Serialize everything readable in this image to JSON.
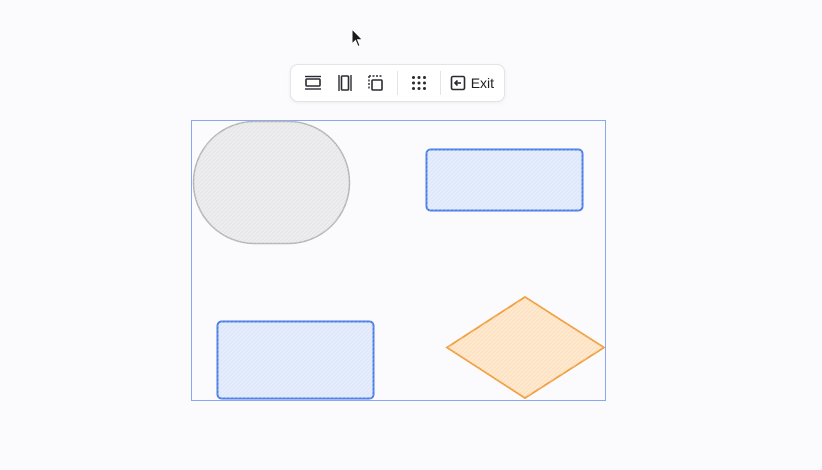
{
  "toolbar": {
    "icons": [
      "distribute-horizontal-icon",
      "distribute-vertical-icon",
      "align-center-icon",
      "grid-icon",
      "exit-icon"
    ],
    "exit_label": "Exit"
  },
  "colors": {
    "selection": "#8aa8ee",
    "rect_fill": "#dfe8fb",
    "rect_stroke": "#4b7fe6",
    "oval_fill": "#e8e8ea",
    "oval_stroke": "#b5b5b8",
    "diamond_fill": "#fde3c4",
    "diamond_stroke": "#f0a040"
  }
}
